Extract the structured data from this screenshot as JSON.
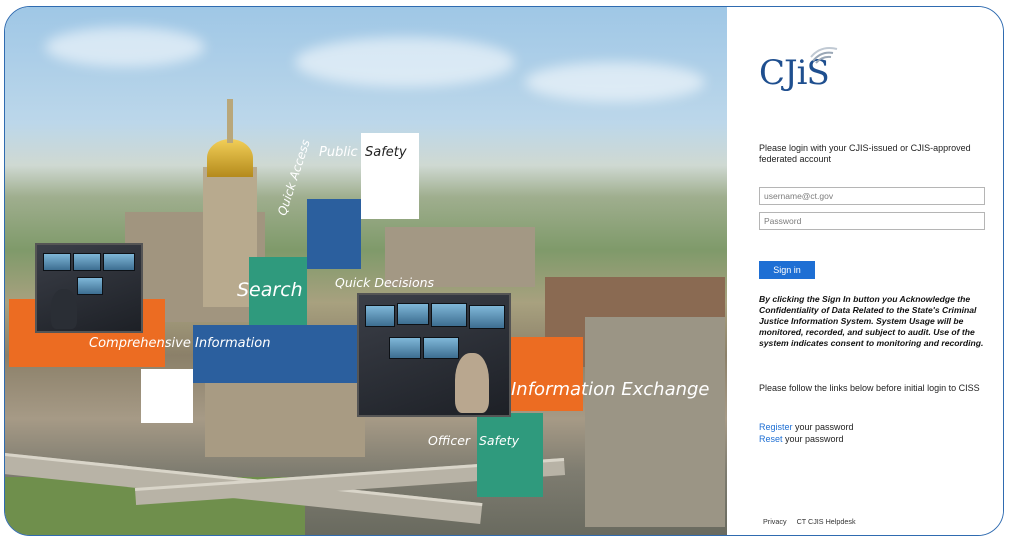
{
  "hero": {
    "tiles": {
      "public": "Public",
      "safety_top": "Safety",
      "quick_access": "Quick Access",
      "search": "Search",
      "quick_decisions": "Quick Decisions",
      "comprehensive": "Comprehensive",
      "information": "Information",
      "info_exchange": "Information Exchange",
      "officer": "Officer",
      "safety_bottom": "Safety"
    },
    "colors": {
      "orange": "#ec6c22",
      "blue": "#2b5f9e",
      "teal": "#2f9a7d",
      "white": "#ffffff"
    }
  },
  "login": {
    "logo_text": "CJiS",
    "prompt": "Please login with your CJIS-issued or CJIS-approved federated account",
    "username_placeholder": "username@ct.gov",
    "password_placeholder": "Password",
    "sign_in_label": "Sign in",
    "notice": "By clicking the Sign In button you Acknowledge the Confidentiality of Data Related to the State's Criminal Justice Information System. System Usage will be monitored, recorded, and subject to audit. Use of the system indicates consent to monitoring and recording.",
    "follow_text": "Please follow the links below before initial login to CISS",
    "register_link": "Register",
    "register_rest": " your password",
    "reset_link": "Reset",
    "reset_rest": " your password",
    "footer": {
      "privacy": "Privacy",
      "helpdesk": "CT CJIS Helpdesk"
    },
    "accent": "#1e6fd4"
  }
}
